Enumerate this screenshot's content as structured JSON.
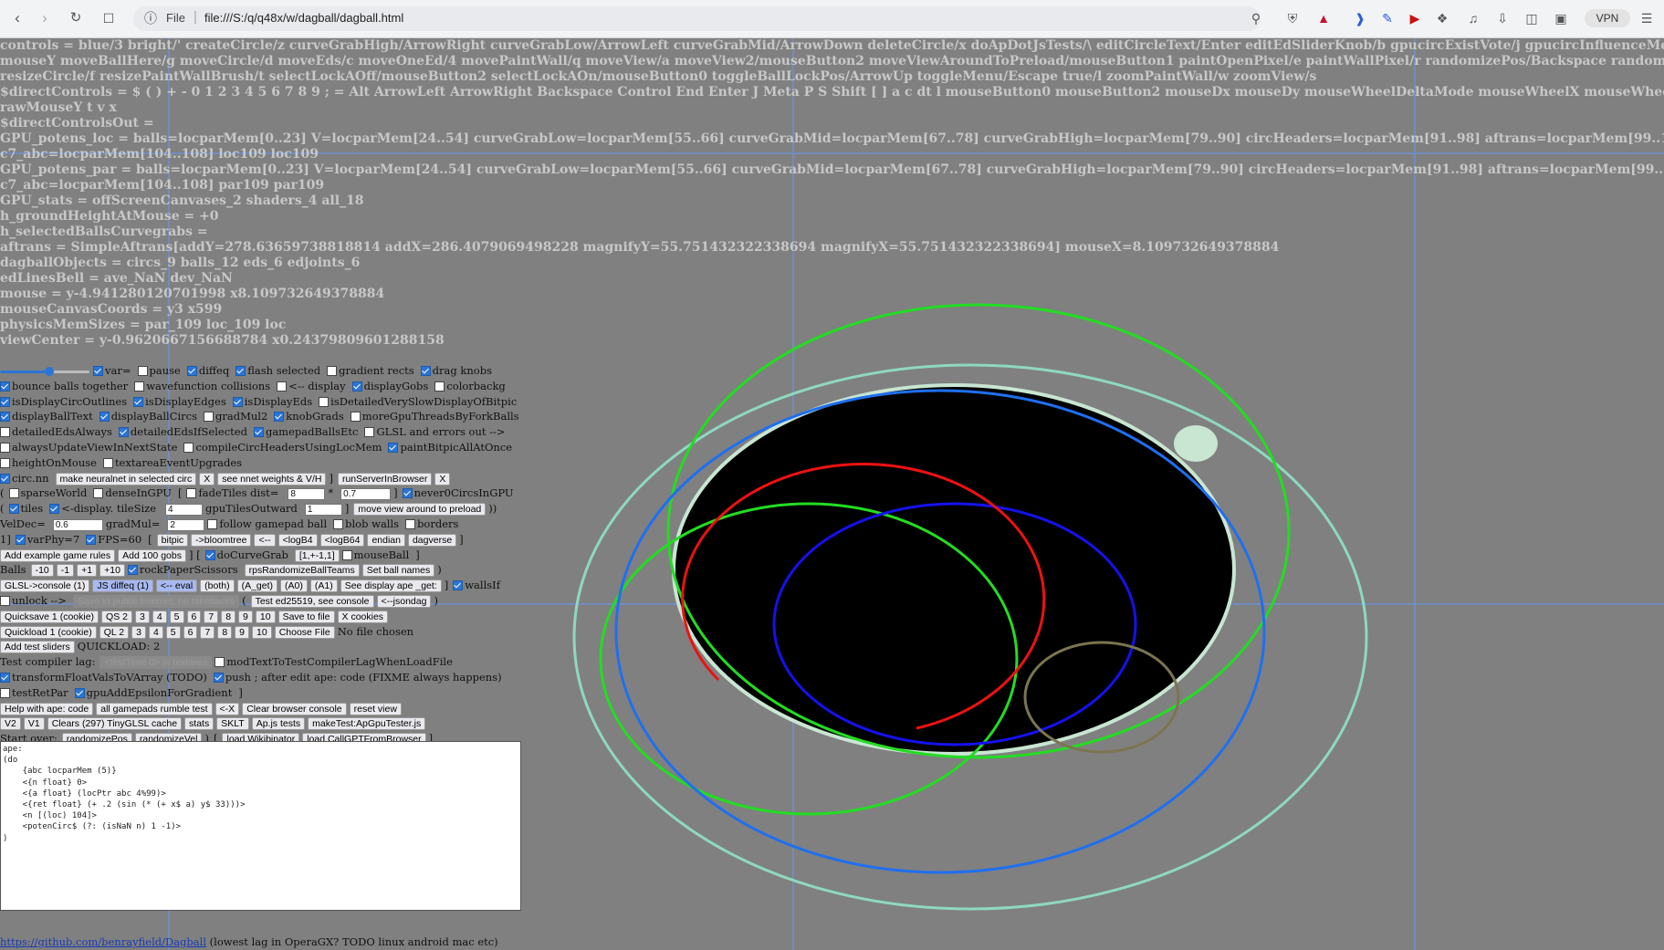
{
  "browser": {
    "back_icon": "arrow-left-icon",
    "forward_icon": "arrow-right-icon",
    "reload_icon": "reload-icon",
    "bookmark_icon": "bookmark-icon",
    "scheme": "File",
    "url": "file:///S:/q/q48x/w/dagball/dagball.html",
    "vpn_label": "VPN"
  },
  "info_lines": [
    {
      "text": "controls = blue/3 bright/' createCircle/z curveGrabHigh/ArrowRight curveGrabLow/ArrowLeft curveGrabMid/ArrowDown deleteCircle/x doApDotJsTests/\\ editCircleText/Enter editEdSliderKnob/b gpucircExistVote/j gpucircInfluenceMedianVote/k green/2 learn/ like/; mouseX"
    },
    {
      "text": "mouseY moveBallHere/g moveCircle/d moveEds/c moveOneEd/4 movePaintWall/q moveView/a moveView2/mouseButton2 moveViewAroundToPreload/mouseButton1 paintOpenPixel/e paintWallPixel/r randomizePos/Backspace randomizeVel/Delete rebuildEdGroup/v red/1"
    },
    {
      "text": "resizeCircle/f resizePaintWallBrush/t selectLockAOff/mouseButton2 selectLockAOn/mouseButton0 toggleBallLockPos/ArrowUp toggleMenu/Escape true/l zoomPaintWall/w zoomView/s"
    },
    {
      "text": "$directControls = $ ( ) + - 0 1 2 3 4 5 6 7 8 9 ; = Alt ArrowLeft ArrowRight Backspace Control End Enter J Meta P S Shift [ ] a c dt l mouseButton0 mouseButton2 mouseDx mouseDy mouseWheelDeltaMode mouseWheelX mouseWheelY mouseWheelZ mouseX mouseY o r rawMouseX"
    },
    {
      "text": "rawMouseY t v x"
    },
    {
      "text": "$directControlsOut ="
    },
    {
      "text": "GPU_potens_loc = balls=locparMem[0..23] V=locparMem[24..54] curveGrabLow=locparMem[55..66] curveGrabMid=locparMem[67..78] curveGrabHigh=locparMem[79..90] circHeaders=locparMem[91..98] aftrans=locparMem[99..102] c0_abc=locparMem[103..103]"
    },
    {
      "text": "c7_abc=locparMem[104..108] loc109 loc109"
    },
    {
      "text": "GPU_potens_par = balls=locparMem[0..23] V=locparMem[24..54] curveGrabLow=locparMem[55..66] curveGrabMid=locparMem[67..78] curveGrabHigh=locparMem[79..90] circHeaders=locparMem[91..98] aftrans=locparMem[99..102] c0_abc=locparMem[103..103]"
    },
    {
      "text": "c7_abc=locparMem[104..108] par109 par109"
    },
    {
      "text": "GPU_stats = offScreenCanvases_2 shaders_4 all_18"
    },
    {
      "text": "h_groundHeightAtMouse = +0"
    },
    {
      "text": "h_selectedBallsCurvegrabs ="
    },
    {
      "text": "aftrans = SimpleAftrans[addY=278.63659738818814 addX=286.4079069498228 magnifyY=55.751432322338694 magnifyX=55.751432322338694] mouseX=8.109732649378884"
    },
    {
      "text": "dagballObjects = circs_9 balls_12 eds_6 edjoints_6"
    },
    {
      "text": "edLinesBell = ave_NaN dev_NaN"
    },
    {
      "text": "mouse = y-4.941280120701998 x8.109732649378884"
    },
    {
      "text": "mouseCanvasCoords = y3 x599"
    },
    {
      "text": "physicsMemSizes = par_109 loc_109 loc"
    },
    {
      "text": "viewCenter = y-0.9620667156688784 x0.24379809601288158"
    }
  ],
  "slider": {
    "value": 0.55
  },
  "controls": {
    "row1": [
      {
        "type": "slider"
      },
      {
        "type": "cb",
        "on": true,
        "label": "var="
      },
      {
        "type": "cb",
        "on": false,
        "label": "pause"
      },
      {
        "type": "cb",
        "on": true,
        "label": "diffeq"
      },
      {
        "type": "cb",
        "on": true,
        "label": "flash selected"
      },
      {
        "type": "cb",
        "on": false,
        "label": "gradient rects"
      },
      {
        "type": "cb",
        "on": true,
        "label": "drag knobs"
      }
    ],
    "row2": [
      {
        "type": "cb",
        "on": true,
        "label": "bounce balls together"
      },
      {
        "type": "cb",
        "on": false,
        "label": "wavefunction collisions"
      },
      {
        "type": "cb",
        "on": false,
        "label": "<-- display"
      },
      {
        "type": "cb",
        "on": true,
        "label": "displayGobs"
      },
      {
        "type": "cb",
        "on": false,
        "label": "colorbackg"
      }
    ],
    "row3": [
      {
        "type": "cb",
        "on": true,
        "label": "isDisplayCircOutlines"
      },
      {
        "type": "cb",
        "on": true,
        "label": "isDisplayEdges"
      },
      {
        "type": "cb",
        "on": true,
        "label": "isDisplayEds"
      },
      {
        "type": "cb",
        "on": false,
        "label": "isDetailedVerySlowDisplayOfBitpic"
      }
    ],
    "row4": [
      {
        "type": "cb",
        "on": true,
        "label": "displayBallText"
      },
      {
        "type": "cb",
        "on": true,
        "label": "displayBallCircs"
      },
      {
        "type": "cb",
        "on": false,
        "label": "gradMul2"
      },
      {
        "type": "cb",
        "on": true,
        "label": "knobGrads"
      },
      {
        "type": "cb",
        "on": false,
        "label": "moreGpuThreadsByForkBalls"
      }
    ],
    "row5": [
      {
        "type": "cb",
        "on": false,
        "label": "detailedEdsAlways"
      },
      {
        "type": "cb",
        "on": true,
        "label": "detailedEdsIfSelected"
      },
      {
        "type": "cb",
        "on": true,
        "label": "gamepadBallsEtc"
      },
      {
        "type": "cb",
        "on": false,
        "label": "GLSL and errors out -->"
      }
    ],
    "row6": [
      {
        "type": "cb",
        "on": false,
        "label": "alwaysUpdateViewInNextState"
      },
      {
        "type": "cb",
        "on": false,
        "label": "compileCircHeadersUsingLocMem"
      },
      {
        "type": "cb",
        "on": true,
        "label": "paintBitpicAllAtOnce"
      }
    ],
    "row7": [
      {
        "type": "cb",
        "on": false,
        "label": "heightOnMouse"
      },
      {
        "type": "cb",
        "on": false,
        "label": "textareaEventUpgrades"
      }
    ],
    "row8": [
      {
        "type": "cb",
        "on": true,
        "label": "circ.nn"
      },
      {
        "type": "btn",
        "label": "make neuralnet in selected circ"
      },
      {
        "type": "btn",
        "label": "X"
      },
      {
        "type": "btn",
        "label": "see nnet weights & V/H"
      },
      {
        "type": "txt",
        "label": "]"
      },
      {
        "type": "btn",
        "label": "runServerInBrowser"
      },
      {
        "type": "btn",
        "label": "X"
      }
    ],
    "row9": [
      {
        "type": "txt",
        "label": "("
      },
      {
        "type": "cb",
        "on": false,
        "label": "sparseWorld"
      },
      {
        "type": "cb",
        "on": false,
        "label": "denseInGPU"
      },
      {
        "type": "txt",
        "label": "["
      },
      {
        "type": "cb",
        "on": false,
        "label": "fadeTiles dist="
      },
      {
        "type": "in",
        "value": "8"
      },
      {
        "type": "txt",
        "label": "*"
      },
      {
        "type": "in",
        "value": "0.7"
      },
      {
        "type": "txt",
        "label": "]"
      },
      {
        "type": "cb",
        "on": true,
        "label": "never0CircsInGPU"
      }
    ],
    "row10": [
      {
        "type": "txt",
        "label": "("
      },
      {
        "type": "cb",
        "on": true,
        "label": "tiles"
      },
      {
        "type": "cb",
        "on": true,
        "label": "<-display. tileSize"
      },
      {
        "type": "in",
        "value": "4"
      },
      {
        "type": "txt",
        "label": "gpuTilesOutward"
      },
      {
        "type": "in",
        "value": "1"
      },
      {
        "type": "txt",
        "label": "]"
      },
      {
        "type": "btn",
        "label": "move view around to preload"
      },
      {
        "type": "txt",
        "label": "))"
      }
    ],
    "row11": [
      {
        "type": "txt",
        "label": "VelDec="
      },
      {
        "type": "in",
        "value": "0.6"
      },
      {
        "type": "txt",
        "label": "gradMul="
      },
      {
        "type": "in",
        "value": "2"
      },
      {
        "type": "cb",
        "on": false,
        "label": "follow gamepad ball"
      },
      {
        "type": "cb",
        "on": false,
        "label": "blob walls"
      },
      {
        "type": "cb",
        "on": false,
        "label": "borders"
      }
    ],
    "row12": [
      {
        "type": "txt",
        "label": "1]"
      },
      {
        "type": "cb",
        "on": true,
        "label": "varPhy=7"
      },
      {
        "type": "cb",
        "on": true,
        "label": "FPS=60"
      },
      {
        "type": "txt",
        "label": "["
      },
      {
        "type": "btn",
        "label": "bitpic"
      },
      {
        "type": "btn",
        "label": "->bloomtree"
      },
      {
        "type": "btn",
        "label": "<--"
      },
      {
        "type": "btn",
        "label": "<logB4"
      },
      {
        "type": "btn",
        "label": "<logB64"
      },
      {
        "type": "btn",
        "label": "endian"
      },
      {
        "type": "btn",
        "label": "dagverse"
      },
      {
        "type": "txt",
        "label": "]"
      }
    ],
    "row13": [
      {
        "type": "btn",
        "label": "Add example game rules"
      },
      {
        "type": "btn",
        "label": "Add 100 gobs"
      },
      {
        "type": "txt",
        "label": "] ["
      },
      {
        "type": "cb",
        "on": true,
        "label": "doCurveGrab"
      },
      {
        "type": "btn",
        "label": "[1,+-1,1]"
      },
      {
        "type": "cb",
        "on": false,
        "label": "mouseBall"
      },
      {
        "type": "txt",
        "label": "]"
      }
    ],
    "row14": [
      {
        "type": "txt",
        "label": "Balls"
      },
      {
        "type": "btn",
        "label": "-10"
      },
      {
        "type": "btn",
        "label": "-1"
      },
      {
        "type": "btn",
        "label": "+1"
      },
      {
        "type": "btn",
        "label": "+10"
      },
      {
        "type": "cb",
        "on": true,
        "label": "rockPaperScissors"
      },
      {
        "type": "btn",
        "label": "rpsRandomizeBallTeams"
      },
      {
        "type": "btn",
        "label": "Set ball names"
      },
      {
        "type": "txt",
        "label": ")"
      }
    ],
    "row15": [
      {
        "type": "btn",
        "label": "GLSL->console (1)"
      },
      {
        "type": "btn",
        "sel": true,
        "label": "JS diffeq (1)"
      },
      {
        "type": "btn",
        "sel": true,
        "label": "<-- eval"
      },
      {
        "type": "btn",
        "label": "(both)"
      },
      {
        "type": "btn",
        "label": "(A_get)"
      },
      {
        "type": "btn",
        "label": "(A0)"
      },
      {
        "type": "btn",
        "label": "(A1)"
      },
      {
        "type": "btn",
        "label": "See display ape _get:"
      },
      {
        "type": "txt",
        "label": "]"
      },
      {
        "type": "cb",
        "on": true,
        "label": "wallsIf"
      }
    ],
    "row16": [
      {
        "type": "cb",
        "on": false,
        "label": "unlock -->"
      },
      {
        "type": "btn",
        "dis": true,
        "label": "Save to public Internet, no takebacks"
      },
      {
        "type": "txt",
        "label": "("
      },
      {
        "type": "btn",
        "label": "Test ed25519, see console"
      },
      {
        "type": "btn",
        "label": "<--jsondag"
      },
      {
        "type": "txt",
        "label": ")"
      }
    ],
    "row17": [
      {
        "type": "btn",
        "label": "Quicksave 1 (cookie)"
      },
      {
        "type": "btn",
        "label": "QS 2"
      },
      {
        "type": "btn",
        "label": "3"
      },
      {
        "type": "btn",
        "label": "4"
      },
      {
        "type": "btn",
        "label": "5"
      },
      {
        "type": "btn",
        "label": "6"
      },
      {
        "type": "btn",
        "label": "7"
      },
      {
        "type": "btn",
        "label": "8"
      },
      {
        "type": "btn",
        "label": "9"
      },
      {
        "type": "btn",
        "label": "10"
      },
      {
        "type": "btn",
        "label": "Save to file"
      },
      {
        "type": "btn",
        "label": "X cookies"
      }
    ],
    "row18": [
      {
        "type": "btn",
        "label": "Quickload 1 (cookie)"
      },
      {
        "type": "btn",
        "label": "QL 2"
      },
      {
        "type": "btn",
        "label": "3"
      },
      {
        "type": "btn",
        "label": "4"
      },
      {
        "type": "btn",
        "label": "5"
      },
      {
        "type": "btn",
        "label": "6"
      },
      {
        "type": "btn",
        "label": "7"
      },
      {
        "type": "btn",
        "label": "8"
      },
      {
        "type": "btn",
        "label": "9"
      },
      {
        "type": "btn",
        "label": "10"
      },
      {
        "type": "btn",
        "label": "Choose File"
      },
      {
        "type": "txt",
        "label": "No file chosen"
      }
    ],
    "row19": [
      {
        "type": "btn",
        "label": "Add test sliders"
      },
      {
        "type": "txt",
        "label": "QUICKLOAD: 2"
      }
    ],
    "row20": [
      {
        "type": "txt",
        "label": "Test compiler lag:"
      },
      {
        "type": "btn",
        "dis": true,
        "label": "<testTime 0> in textarea"
      },
      {
        "type": "cb",
        "on": false,
        "label": "modTextToTestCompilerLagWhenLoadFile"
      }
    ],
    "row21": [
      {
        "type": "cb",
        "on": true,
        "label": "transformFloatValsToVArray (TODO)"
      },
      {
        "type": "cb",
        "on": true,
        "label": "push ; after edit ape: code (FIXME always happens)"
      }
    ],
    "row22": [
      {
        "type": "cb",
        "on": false,
        "label": "testRetPar"
      },
      {
        "type": "cb",
        "on": true,
        "label": "gpuAddEpsilonForGradient"
      },
      {
        "type": "txt",
        "label": "]"
      }
    ],
    "row23": [
      {
        "type": "btn",
        "label": "Help with ape: code"
      },
      {
        "type": "btn",
        "label": "all gamepads rumble test"
      },
      {
        "type": "btn",
        "label": "<-X"
      },
      {
        "type": "btn",
        "label": "Clear browser console"
      },
      {
        "type": "btn",
        "label": "reset view"
      }
    ],
    "row24": [
      {
        "type": "btn",
        "label": "V2"
      },
      {
        "type": "btn",
        "label": "V1"
      },
      {
        "type": "btn",
        "label": "Clears (297) TinyGLSL cache"
      },
      {
        "type": "btn",
        "label": "stats"
      },
      {
        "type": "btn",
        "label": "SKLT"
      },
      {
        "type": "btn",
        "label": "Ap.js tests"
      },
      {
        "type": "btn",
        "label": "makeTest:ApGpuTester.js"
      }
    ],
    "row25": [
      {
        "type": "txt",
        "label": "Start over:"
      },
      {
        "type": "btn",
        "label": "randomizePos"
      },
      {
        "type": "btn",
        "label": "randomizeVel"
      },
      {
        "type": "txt",
        "label": ")"
      },
      {
        "type": "txt",
        "label": "["
      },
      {
        "type": "btn",
        "label": "load Wikibinator"
      },
      {
        "type": "btn",
        "label": "load CallGPTFromBrowser"
      },
      {
        "type": "txt",
        "label": "]"
      }
    ]
  },
  "code_editor": {
    "text": "ape:\n(do\n    {abc locparMem (5)}\n    <{n float} 0>\n    <{a float} (locPtr abc 4%99)>\n    <{ret float} (+ .2 (sin (* (+ x$ a) y$ 33)))>\n    <n [(loc) 104]>\n    <potenCirc$ (?: (isNaN n) 1 -1)>\n)"
  },
  "footer": {
    "link": "https://github.com/benrayfield/Dagball",
    "note": " (lowest lag in OperaGX? TODO linux android mac etc)"
  },
  "colors": {
    "background": "#808080",
    "crosshair": "#6f8fcf",
    "ellipse_fill": "#000000",
    "ellipse_outline": "#c8e6d2",
    "teal": "#8fd8c0",
    "green": "#22dd22",
    "blue": "#1f6ff0",
    "red": "#ee1111",
    "olive": "#7b7550",
    "ball": "#c8e6d2"
  }
}
